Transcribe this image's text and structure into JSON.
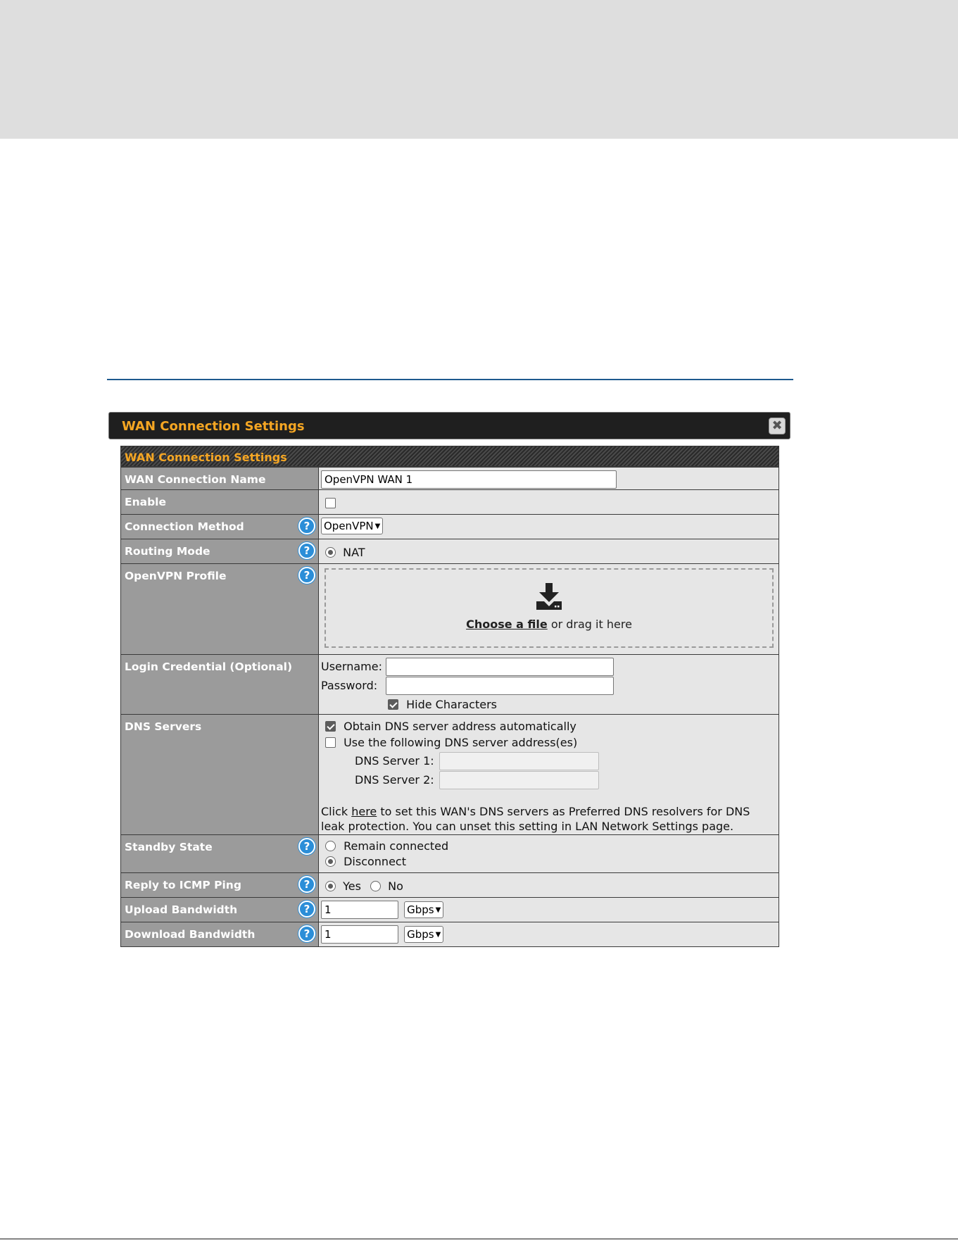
{
  "dialog": {
    "title": "WAN Connection Settings",
    "close_symbol": "✖"
  },
  "section": {
    "header": "WAN Connection Settings"
  },
  "fields": {
    "name": {
      "label": "WAN Connection Name",
      "value": "OpenVPN WAN 1"
    },
    "enable": {
      "label": "Enable",
      "checked": false
    },
    "method": {
      "label": "Connection Method",
      "value": "OpenVPN"
    },
    "routing": {
      "label": "Routing Mode",
      "option": "NAT"
    },
    "profile": {
      "label": "OpenVPN Profile",
      "choose_link": "Choose a file",
      "drag_text": "or drag it here"
    },
    "login": {
      "label": "Login Credential (Optional)",
      "username_label": "Username:",
      "username_value": "",
      "password_label": "Password:",
      "password_value": "",
      "hide_label": "Hide Characters"
    },
    "dns": {
      "label": "DNS Servers",
      "auto_label": "Obtain DNS server address automatically",
      "manual_label": "Use the following DNS server address(es)",
      "server1_label": "DNS Server 1:",
      "server2_label": "DNS Server 2:",
      "note_prefix": "Click",
      "note_link": "here",
      "note_line1": "to set this WAN's DNS servers as Preferred DNS resolvers for DNS",
      "note_line2": "leak protection. You can unset this setting in LAN Network Settings page."
    },
    "standby": {
      "label": "Standby State",
      "option1": "Remain connected",
      "option2": "Disconnect"
    },
    "icmp": {
      "label": "Reply to ICMP Ping",
      "yes": "Yes",
      "no": "No"
    },
    "upload": {
      "label": "Upload Bandwidth",
      "value": "1",
      "unit": "Gbps"
    },
    "download": {
      "label": "Download Bandwidth",
      "value": "1",
      "unit": "Gbps"
    }
  },
  "help_symbol": "?",
  "icons": {
    "help": "question-circle-icon",
    "download": "download-tray-icon",
    "close": "close-icon"
  },
  "colors": {
    "accent": "#f5a623",
    "help_blue": "#2b8ed8",
    "label_bg": "#9b9b9b",
    "value_bg": "#e6e6e6",
    "rule": "#1e5a8e"
  }
}
